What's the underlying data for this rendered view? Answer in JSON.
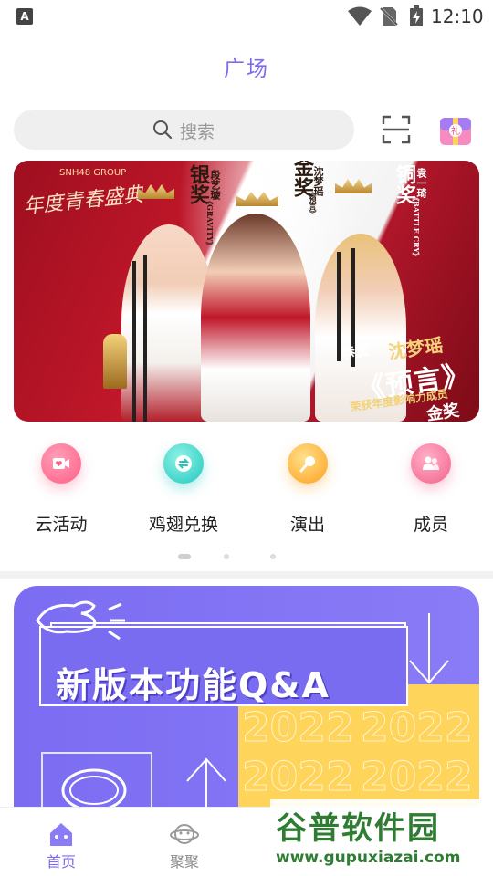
{
  "status_bar": {
    "app_icon_letter": "A",
    "time": "12:10"
  },
  "header": {
    "title": "广场"
  },
  "search": {
    "placeholder": "搜索"
  },
  "banner": {
    "logo": "SNH48 GROUP",
    "calligraphy": "年度青春盛典",
    "silver": "银奖",
    "silver_name": "段艺璇",
    "silver_song": "《GRAVITY》",
    "gold": "金奖",
    "gold_name": "沈梦瑶",
    "gold_song": "《预言》",
    "bronze": "铜奖",
    "bronze_name": "袁一琦",
    "bronze_song": "《BATTLE CRY》",
    "congrats": "恭贺",
    "congrats_name": "沈梦瑶",
    "song_title": "《预言》",
    "award_line": "荣获年度影响力成员",
    "award_gold": "金奖"
  },
  "quick_entries": [
    {
      "label": "云活动",
      "icon": "video-heart-icon"
    },
    {
      "label": "鸡翅兑换",
      "icon": "exchange-icon"
    },
    {
      "label": "演出",
      "icon": "microphone-icon"
    },
    {
      "label": "成员",
      "icon": "members-icon"
    }
  ],
  "pager": {
    "pages": 3,
    "active_index": 0
  },
  "qa_card": {
    "title": "新版本功能Q&A",
    "year": "2022"
  },
  "bottom_nav": [
    {
      "label": "首页",
      "active": true
    },
    {
      "label": "聚聚",
      "active": false
    }
  ],
  "watermark": {
    "title": "谷普软件园",
    "url": "www.gupuxiazai.com"
  },
  "colors": {
    "accent": "#7b6cf0",
    "search_bg": "#efefef",
    "watermark": "#2f7d32"
  }
}
